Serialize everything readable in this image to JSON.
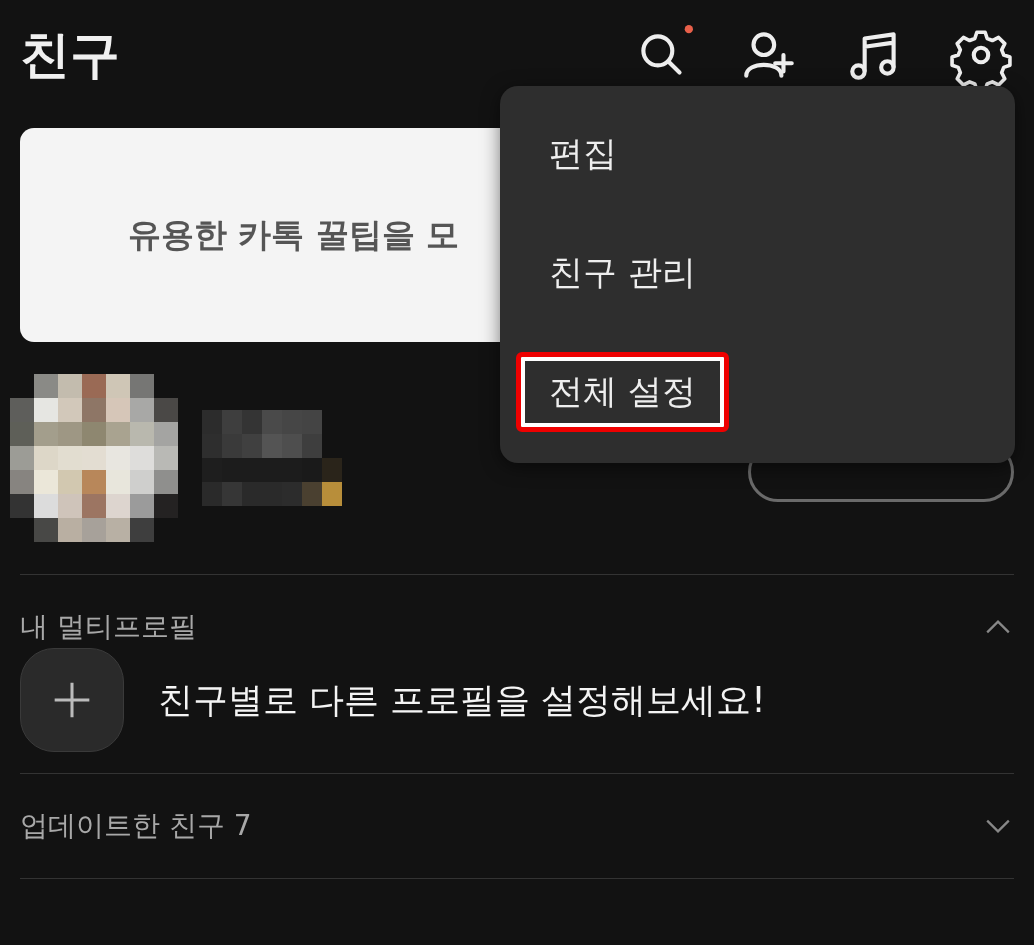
{
  "header": {
    "title": "친구",
    "search_has_badge": true
  },
  "banner": {
    "text": "유용한 카톡 꿀팁을 모"
  },
  "multi_profile": {
    "title": "내 멀티프로필",
    "expanded": true,
    "prompt": "친구별로 다른 프로필을 설정해보세요!"
  },
  "updated_friends": {
    "title": "업데이트한 친구 7",
    "expanded": false
  },
  "menu": {
    "items": [
      {
        "label": "편집",
        "highlighted": false
      },
      {
        "label": "친구 관리",
        "highlighted": false
      },
      {
        "label": "전체 설정",
        "highlighted": true
      }
    ]
  }
}
